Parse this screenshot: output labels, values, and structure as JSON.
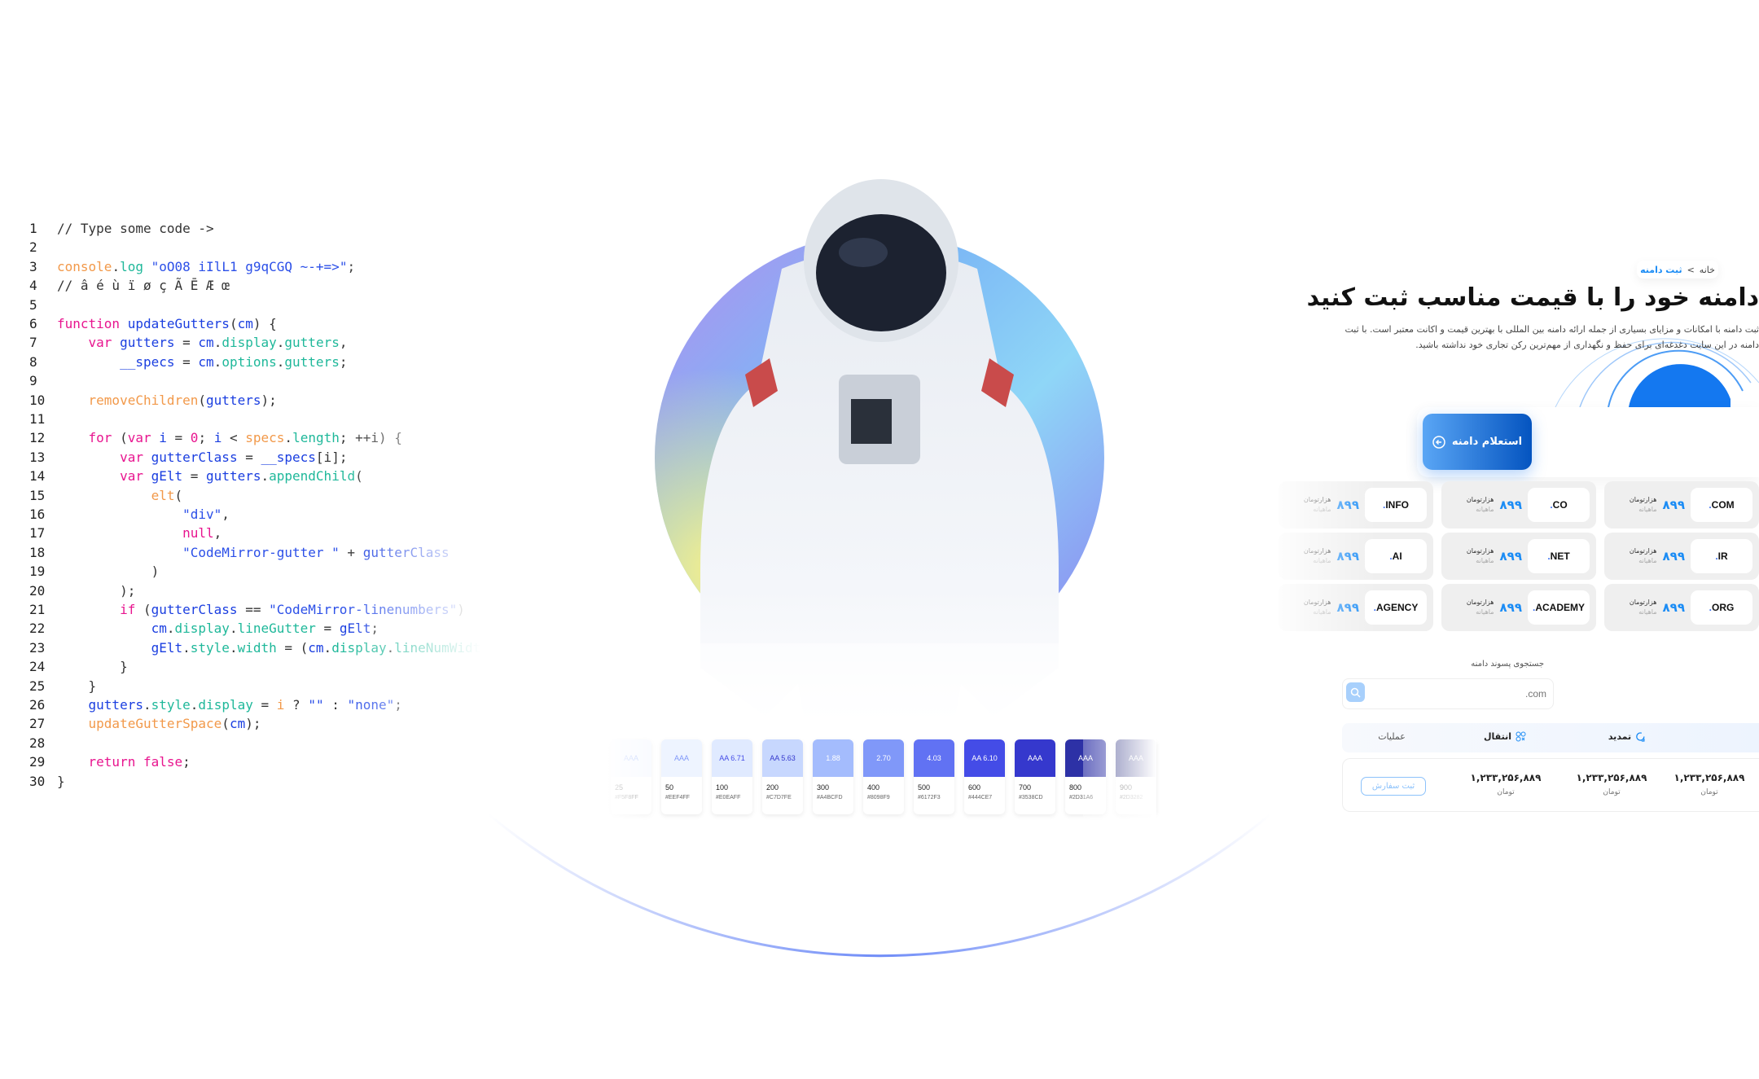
{
  "code": {
    "lines": [
      [
        [
          "cm",
          "// Type some code ->"
        ]
      ],
      [],
      [
        [
          "or",
          "console"
        ],
        [
          "cm",
          "."
        ],
        [
          "pr",
          "log"
        ],
        [
          "cm",
          " "
        ],
        [
          "st",
          "\"oO08 iIlL1 g9qCGQ ~-+=>\""
        ],
        [
          "cm",
          ";"
        ]
      ],
      [
        [
          "cm",
          "// â é ù ï ø ç Ã Ē Æ œ"
        ]
      ],
      [],
      [
        [
          "kw",
          "function"
        ],
        [
          "cm",
          " "
        ],
        [
          "fn",
          "updateGutters"
        ],
        [
          "cm",
          "("
        ],
        [
          "fn",
          "cm"
        ],
        [
          "cm",
          ") {"
        ]
      ],
      [
        [
          "cm",
          "    "
        ],
        [
          "kw",
          "var"
        ],
        [
          "cm",
          " "
        ],
        [
          "fn",
          "gutters"
        ],
        [
          "cm",
          " = "
        ],
        [
          "fn",
          "cm"
        ],
        [
          "cm",
          "."
        ],
        [
          "pr",
          "display"
        ],
        [
          "cm",
          "."
        ],
        [
          "pr",
          "gutters"
        ],
        [
          "cm",
          ","
        ]
      ],
      [
        [
          "cm",
          "        "
        ],
        [
          "fn",
          "__specs"
        ],
        [
          "cm",
          " = "
        ],
        [
          "fn",
          "cm"
        ],
        [
          "cm",
          "."
        ],
        [
          "pr",
          "options"
        ],
        [
          "cm",
          "."
        ],
        [
          "pr",
          "gutters"
        ],
        [
          "cm",
          ";"
        ]
      ],
      [],
      [
        [
          "cm",
          "    "
        ],
        [
          "or",
          "removeChildren"
        ],
        [
          "cm",
          "("
        ],
        [
          "fn",
          "gutters"
        ],
        [
          "cm",
          ");"
        ]
      ],
      [],
      [
        [
          "cm",
          "    "
        ],
        [
          "kw",
          "for"
        ],
        [
          "cm",
          " ("
        ],
        [
          "kw",
          "var"
        ],
        [
          "cm",
          " "
        ],
        [
          "fn",
          "i"
        ],
        [
          "cm",
          " = "
        ],
        [
          "kw",
          "0"
        ],
        [
          "cm",
          "; "
        ],
        [
          "fn",
          "i"
        ],
        [
          "cm",
          " < "
        ],
        [
          "or",
          "specs"
        ],
        [
          "cm",
          "."
        ],
        [
          "pr",
          "length"
        ],
        [
          "cm",
          "; ++i) {"
        ]
      ],
      [
        [
          "cm",
          "        "
        ],
        [
          "kw",
          "var"
        ],
        [
          "cm",
          " "
        ],
        [
          "fn",
          "gutterClass"
        ],
        [
          "cm",
          " = "
        ],
        [
          "fn",
          "__specs"
        ],
        [
          "cm",
          "[i];"
        ]
      ],
      [
        [
          "cm",
          "        "
        ],
        [
          "kw",
          "var"
        ],
        [
          "cm",
          " "
        ],
        [
          "fn",
          "gElt"
        ],
        [
          "cm",
          " = "
        ],
        [
          "fn",
          "gutters"
        ],
        [
          "cm",
          "."
        ],
        [
          "pr",
          "appendChild"
        ],
        [
          "cm",
          "("
        ]
      ],
      [
        [
          "cm",
          "            "
        ],
        [
          "or",
          "elt"
        ],
        [
          "cm",
          "("
        ]
      ],
      [
        [
          "cm",
          "                "
        ],
        [
          "st",
          "\"div\""
        ],
        [
          "cm",
          ","
        ]
      ],
      [
        [
          "cm",
          "                "
        ],
        [
          "kw",
          "null"
        ],
        [
          "cm",
          ","
        ]
      ],
      [
        [
          "cm",
          "                "
        ],
        [
          "st",
          "\"CodeMirror-gutter \""
        ],
        [
          "cm",
          " + "
        ],
        [
          "fn",
          "gutterClass"
        ]
      ],
      [
        [
          "cm",
          "            )"
        ]
      ],
      [
        [
          "cm",
          "        );"
        ]
      ],
      [
        [
          "cm",
          "        "
        ],
        [
          "kw",
          "if"
        ],
        [
          "cm",
          " ("
        ],
        [
          "fn",
          "gutterClass"
        ],
        [
          "cm",
          " == "
        ],
        [
          "st",
          "\"CodeMirror-linenumbers\""
        ],
        [
          "cm",
          ")"
        ]
      ],
      [
        [
          "cm",
          "            "
        ],
        [
          "fn",
          "cm"
        ],
        [
          "cm",
          "."
        ],
        [
          "pr",
          "display"
        ],
        [
          "cm",
          "."
        ],
        [
          "pr",
          "lineGutter"
        ],
        [
          "cm",
          " = "
        ],
        [
          "fn",
          "gElt"
        ],
        [
          "cm",
          ";"
        ]
      ],
      [
        [
          "cm",
          "            "
        ],
        [
          "fn",
          "gElt"
        ],
        [
          "cm",
          "."
        ],
        [
          "pr",
          "style"
        ],
        [
          "cm",
          "."
        ],
        [
          "pr",
          "width"
        ],
        [
          "cm",
          " = ("
        ],
        [
          "fn",
          "cm"
        ],
        [
          "cm",
          "."
        ],
        [
          "pr",
          "display"
        ],
        [
          "cm",
          "."
        ],
        [
          "pr",
          "lineNumWidth"
        ]
      ],
      [
        [
          "cm",
          "        }"
        ]
      ],
      [
        [
          "cm",
          "    }"
        ]
      ],
      [
        [
          "cm",
          "    "
        ],
        [
          "fn",
          "gutters"
        ],
        [
          "cm",
          "."
        ],
        [
          "pr",
          "style"
        ],
        [
          "cm",
          "."
        ],
        [
          "pr",
          "display"
        ],
        [
          "cm",
          " = "
        ],
        [
          "or",
          "i"
        ],
        [
          "cm",
          " ? "
        ],
        [
          "st",
          "\"\""
        ],
        [
          "cm",
          " : "
        ],
        [
          "st",
          "\"none\""
        ],
        [
          "cm",
          ";"
        ]
      ],
      [
        [
          "cm",
          "    "
        ],
        [
          "or",
          "updateGutterSpace"
        ],
        [
          "cm",
          "("
        ],
        [
          "fn",
          "cm"
        ],
        [
          "cm",
          ");"
        ]
      ],
      [],
      [
        [
          "cm",
          "    "
        ],
        [
          "kw",
          "return"
        ],
        [
          "cm",
          " "
        ],
        [
          "kw",
          "false"
        ],
        [
          "cm",
          ";"
        ]
      ],
      [
        [
          "cm",
          "}"
        ]
      ]
    ]
  },
  "palette": [
    {
      "badge": "AAA",
      "step": "25",
      "hex": "#F5F8FF",
      "color": "#F5F8FF",
      "text": "#A4BCFD"
    },
    {
      "badge": "AAA",
      "step": "50",
      "hex": "#EEF4FF",
      "color": "#EEF4FF",
      "text": "#8098F9"
    },
    {
      "badge": "AA 6.71",
      "step": "100",
      "hex": "#E0EAFF",
      "color": "#E0EAFF",
      "text": "#444CE7"
    },
    {
      "badge": "AA 5.63",
      "step": "200",
      "hex": "#C7D7FE",
      "color": "#C7D7FE",
      "text": "#3538CD"
    },
    {
      "badge": "1.88",
      "step": "300",
      "hex": "#A4BCFD",
      "color": "#A4BCFD",
      "text": "#ffffff"
    },
    {
      "badge": "2.70",
      "step": "400",
      "hex": "#8098F9",
      "color": "#8098F9",
      "text": "#ffffff"
    },
    {
      "badge": "4.03",
      "step": "500",
      "hex": "#6172F3",
      "color": "#6172F3",
      "text": "#ffffff"
    },
    {
      "badge": "AA 6.10",
      "step": "600",
      "hex": "#444CE7",
      "color": "#444CE7",
      "text": "#ffffff"
    },
    {
      "badge": "AAA",
      "step": "700",
      "hex": "#3538CD",
      "color": "#3538CD",
      "text": "#ffffff"
    },
    {
      "badge": "AAA",
      "step": "800",
      "hex": "#2D31A6",
      "color": "#2D31A6",
      "text": "#ffffff"
    },
    {
      "badge": "AAA",
      "step": "900",
      "hex": "#2D3282",
      "color": "#2D3282",
      "text": "#ffffff"
    }
  ],
  "domain_page": {
    "breadcrumb": {
      "home": "خانه",
      "sep": ">",
      "current": "ثبت دامنه"
    },
    "title": "دامنه خود را با قیمت مناسب ثبت کنید",
    "description": [
      "ثبت دامنه با امکانات و مزایای بسیاری از جمله ارائه دامنه بین المللی با بهترین قیمت و اکانت معتبر است. با ثبت",
      "دامنه در این سایت دغدغه‌ای برای حفظ و نگهداری از مهم‌ترین رکن تجاری خود نداشته باشید."
    ],
    "inquiry_button": "استعلام دامنه",
    "cards": [
      {
        "tld": "COM",
        "price": "۸۹۹",
        "unit": "هزارتومان",
        "period": "ماهیانه"
      },
      {
        "tld": "CO",
        "price": "۸۹۹",
        "unit": "هزارتومان",
        "period": "ماهیانه"
      },
      {
        "tld": "INFO",
        "price": "۸۹۹",
        "unit": "هزارتومان",
        "period": "ماهیانه"
      },
      {
        "tld": "IR",
        "price": "۸۹۹",
        "unit": "هزارتومان",
        "period": "ماهیانه"
      },
      {
        "tld": "NET",
        "price": "۸۹۹",
        "unit": "هزارتومان",
        "period": "ماهیانه"
      },
      {
        "tld": "AI",
        "price": "۸۹۹",
        "unit": "هزارتومان",
        "period": "ماهیانه"
      },
      {
        "tld": "ORG",
        "price": "۸۹۹",
        "unit": "هزارتومان",
        "period": "ماهیانه"
      },
      {
        "tld": "ACADEMY",
        "price": "۸۹۹",
        "unit": "هزارتومان",
        "period": "ماهیانه"
      },
      {
        "tld": "AGENCY",
        "price": "۸۹۹",
        "unit": "هزارتومان",
        "period": "ماهیانه"
      }
    ],
    "search": {
      "label": "جستجوی پسوند دامنه",
      "placeholder": ".com"
    },
    "table": {
      "headers": {
        "renew": "تمدید",
        "transfer": "انتقال",
        "actions": "عملیات"
      },
      "row": {
        "register": "۱,۲۳۳,۲۵۶,۸۸۹",
        "renew": "۱,۲۳۳,۲۵۶,۸۸۹",
        "transfer": "۱,۲۳۳,۲۵۶,۸۸۹",
        "currency": "تومان",
        "order_button": "ثبت سفارش"
      }
    }
  },
  "colors": {
    "accent": "#1b8cf5",
    "arc": "#6f8cf7"
  }
}
